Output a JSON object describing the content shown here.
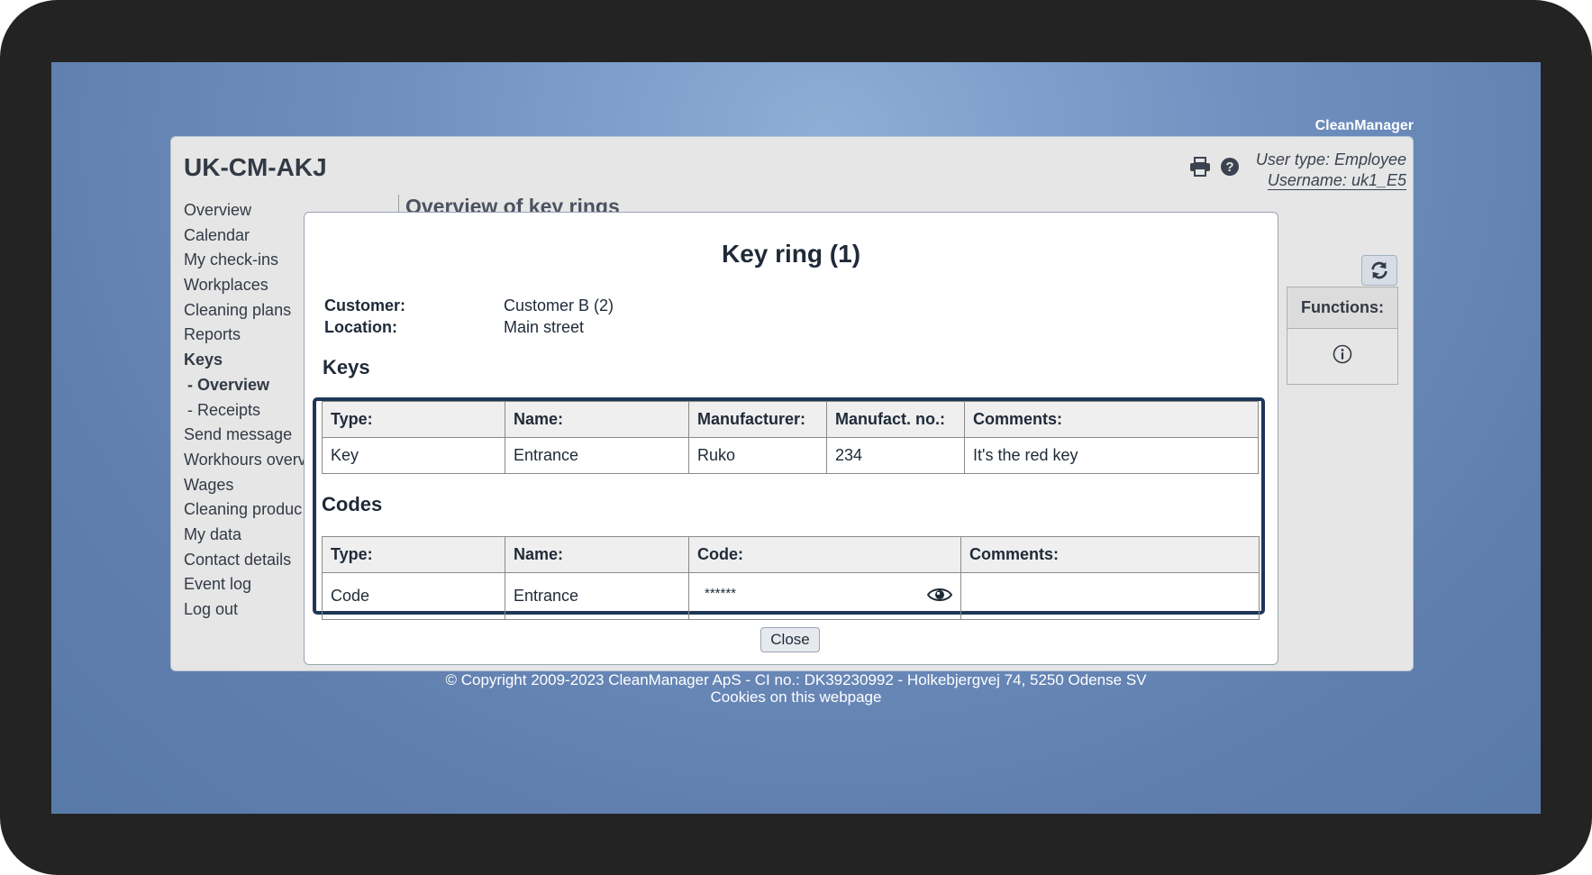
{
  "app": {
    "brand": "CleanManager",
    "title": "UK-CM-AKJ",
    "user_type": "User type: Employee",
    "username": "Username: uk1_E5"
  },
  "sidebar": {
    "items": [
      {
        "label": "Overview"
      },
      {
        "label": "Calendar"
      },
      {
        "label": "My check-ins"
      },
      {
        "label": "Workplaces"
      },
      {
        "label": "Cleaning plans"
      },
      {
        "label": "Reports"
      },
      {
        "label": "Keys"
      },
      {
        "label": "- Overview"
      },
      {
        "label": "- Receipts"
      },
      {
        "label": "Send message"
      },
      {
        "label": "Workhours overv"
      },
      {
        "label": "Wages"
      },
      {
        "label": "Cleaning produc"
      },
      {
        "label": "My data"
      },
      {
        "label": "Contact details"
      },
      {
        "label": "Event log"
      },
      {
        "label": "Log out"
      }
    ]
  },
  "content": {
    "heading": "Overview of key rings",
    "functions_header": "Functions:"
  },
  "modal": {
    "title": "Key ring (1)",
    "customer_label": "Customer:",
    "customer_value": "Customer B (2)",
    "location_label": "Location:",
    "location_value": "Main street",
    "keys_title": "Keys",
    "keys_table": {
      "headers": [
        "Type:",
        "Name:",
        "Manufacturer:",
        "Manufact. no.:",
        "Comments:"
      ],
      "rows": [
        [
          "Key",
          "Entrance",
          "Ruko",
          "234",
          "It's the red key"
        ]
      ]
    },
    "codes_title": "Codes",
    "codes_table": {
      "headers": [
        "Type:",
        "Name:",
        "Code:",
        "Comments:"
      ],
      "rows": [
        [
          "Code",
          "Entrance",
          "******",
          ""
        ]
      ]
    },
    "close_label": "Close"
  },
  "footer": {
    "copyright": "© Copyright 2009-2023 CleanManager ApS - CI no.: DK39230992 - Holkebjergvej 74, 5250 Odense SV",
    "cookies": "Cookies on this webpage"
  },
  "colors": {
    "frame_accent": "#1e3756",
    "title_text": "#1f2a38"
  }
}
